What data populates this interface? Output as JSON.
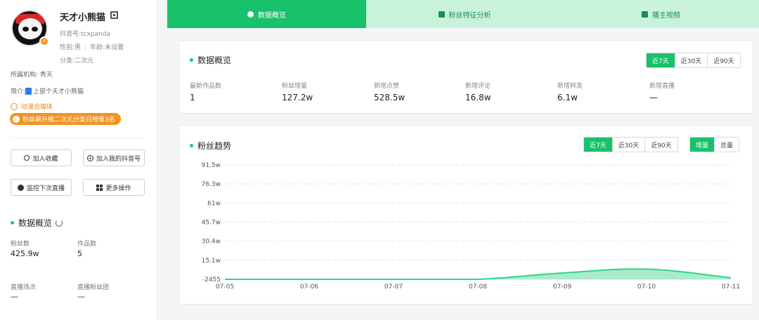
{
  "profile": {
    "name": "天才小熊猫",
    "douyin_id": "抖音号:tcxpanda",
    "gender": "性别:男",
    "age": "年龄:未设置",
    "category": "分类:二次元",
    "org": "所属机构: 秀天",
    "intro_prefix": "简介:",
    "intro_text": "上部个天才小熊猫",
    "tag": "动漫自媒体",
    "rank_badge": "粉丝飙升榜二次元分类日榜第3名"
  },
  "actions": {
    "favorite": "加入收藏",
    "add_douyin": "加入我的抖音号",
    "monitor_live": "监控下次直播",
    "more": "更多操作"
  },
  "side_overview": {
    "title": "数据概览",
    "fans_label": "粉丝数",
    "fans_value": "425.9w",
    "works_label": "作品数",
    "works_value": "5",
    "live_label": "直播场次",
    "live_value": "—",
    "fanclub_label": "直播粉丝团",
    "fanclub_value": "—"
  },
  "tabs": [
    {
      "label": "数据概览",
      "icon": "pie-chart-icon"
    },
    {
      "label": "粉丝特征分析",
      "icon": "user-card-icon"
    },
    {
      "label": "播主视频",
      "icon": "video-icon"
    }
  ],
  "overview": {
    "title": "数据概览",
    "ranges": [
      "近7天",
      "近30天",
      "近90天"
    ],
    "selected_range": "近7天",
    "metrics": [
      {
        "label": "最新作品数",
        "value": "1"
      },
      {
        "label": "粉丝增量",
        "value": "127.2w"
      },
      {
        "label": "新增点赞",
        "value": "528.5w"
      },
      {
        "label": "新增评论",
        "value": "16.8w"
      },
      {
        "label": "新增转发",
        "value": "6.1w"
      },
      {
        "label": "新增直播",
        "value": "—"
      }
    ]
  },
  "trend": {
    "title": "粉丝趋势",
    "ranges": [
      "近7天",
      "近30天",
      "近90天"
    ],
    "modes": [
      "增量",
      "总量"
    ]
  },
  "colors": {
    "accent": "#18c26a",
    "accent_light": "#c9f2db",
    "orange": "#f39321",
    "area_fill": "#9ae9c3",
    "area_line": "#2fd48a"
  },
  "chart_data": {
    "type": "area",
    "x": [
      "07-05",
      "07-06",
      "07-07",
      "07-08",
      "07-09",
      "07-10",
      "07-11"
    ],
    "values": [
      -2455,
      -2455,
      -2455,
      -2455,
      48000,
      79000,
      10000
    ],
    "y_ticks": [
      "-2455",
      "15.1w",
      "30.4w",
      "45.7w",
      "61w",
      "76.3w",
      "91.5w"
    ],
    "ylim": [
      -2455,
      915000
    ],
    "grid": true
  }
}
